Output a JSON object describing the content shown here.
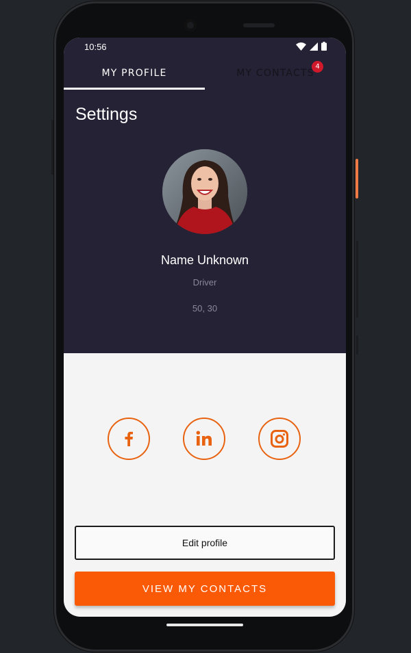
{
  "status_bar": {
    "time": "10:56"
  },
  "tabs": [
    {
      "label": "MY PROFILE",
      "active": true
    },
    {
      "label": "MY CONTACTS",
      "active": false,
      "badge": "4"
    }
  ],
  "page": {
    "title": "Settings"
  },
  "profile": {
    "name": "Name Unknown",
    "role": "Driver",
    "coordinates": "50, 30"
  },
  "social_links": [
    {
      "name": "facebook",
      "icon": "facebook-icon",
      "glyph": "f"
    },
    {
      "name": "linkedin",
      "icon": "linkedin-icon",
      "glyph": "in"
    },
    {
      "name": "instagram",
      "icon": "instagram-icon"
    }
  ],
  "actions": {
    "edit_profile": "Edit profile",
    "view_contacts": "VIEW MY CONTACTS"
  },
  "colors": {
    "accent": "#fa5a06",
    "header_bg": "#242234",
    "badge": "#d0192b",
    "body_bg": "#f4f4f4"
  }
}
